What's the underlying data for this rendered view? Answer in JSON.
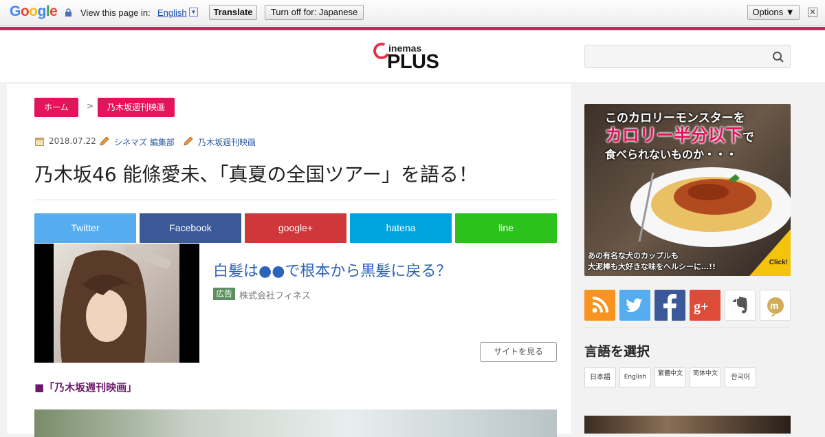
{
  "translate_bar": {
    "logo_letters": [
      "G",
      "o",
      "o",
      "g",
      "l",
      "e"
    ],
    "logo_colors": [
      "#4285f4",
      "#ea4335",
      "#fbbc05",
      "#4285f4",
      "#34a853",
      "#ea4335"
    ],
    "prompt": "View this page in:",
    "language": "English",
    "dropdown": "▼",
    "translate_button": "Translate",
    "turn_off_button": "Turn off for: Japanese",
    "options_button": "Options ▼",
    "close": "✕"
  },
  "header": {
    "logo_top": "inemas",
    "logo_bottom": "PLUS",
    "search_placeholder": ""
  },
  "breadcrumb": {
    "home": "ホーム",
    "separator": ">",
    "current": "乃木坂週刊映画"
  },
  "article": {
    "date": "2018.07.22",
    "author": "シネマズ 編集部",
    "category": "乃木坂週刊映画",
    "title": "乃木坂46 能條愛未、「真夏の全国ツアー」を語る！",
    "section_heading": "■「乃木坂週刊映画」"
  },
  "share": [
    {
      "label": "Twitter",
      "color": "#55acee"
    },
    {
      "label": "Facebook",
      "color": "#3b5998"
    },
    {
      "label": "google+",
      "color": "#d0373a"
    },
    {
      "label": "hatena",
      "color": "#00a4de"
    },
    {
      "label": "line",
      "color": "#2bc21b"
    }
  ],
  "ad": {
    "title": "白髪は●●で根本から黒髪に戻る？",
    "badge": "広告",
    "company": "株式会社フィネス",
    "button": "サイトを見る"
  },
  "banner": {
    "line1": "このカロリーモンスターを",
    "line2_main": "カロリー半分以下",
    "line2_suffix": "で",
    "line3": "食べられないものか・・・",
    "bottom1": "あの有名な犬のカップルも",
    "bottom2": "大泥棒も大好きな味をヘルシーに…!!",
    "click": "Click!"
  },
  "social_icons": [
    {
      "name": "rss",
      "color": "#f7931e"
    },
    {
      "name": "twitter",
      "color": "#55acee"
    },
    {
      "name": "facebook",
      "color": "#3b5998"
    },
    {
      "name": "google-plus",
      "color": "#dd4b39"
    },
    {
      "name": "evernote",
      "color": "#ffffff"
    },
    {
      "name": "mixi",
      "color": "#ffffff"
    }
  ],
  "languages": {
    "heading": "言語を選択",
    "items": [
      "日本語",
      "English",
      "繁體中文",
      "简体中文",
      "한국어"
    ]
  }
}
